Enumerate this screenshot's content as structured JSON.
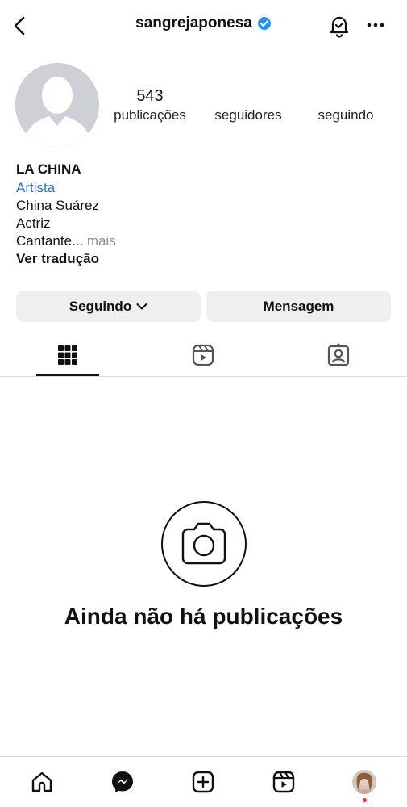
{
  "header": {
    "username": "sangrejaponesa"
  },
  "profile": {
    "stats": [
      {
        "value": "543",
        "label": "publicações"
      },
      {
        "value": "",
        "label": "seguidores"
      },
      {
        "value": "",
        "label": "seguindo"
      }
    ],
    "name": "LA CHINA",
    "category": "Artista",
    "bio_lines": [
      "China Suárez",
      "Actriz",
      "Cantante..."
    ],
    "more_label": "mais",
    "translate_label": "Ver tradução"
  },
  "actions": {
    "following_label": "Seguindo",
    "message_label": "Mensagem"
  },
  "empty_state": {
    "title": "Ainda não há publicações"
  },
  "colors": {
    "link": "#1f78c8",
    "verified": "#1f97f2",
    "notification_dot": "#ff3040"
  }
}
